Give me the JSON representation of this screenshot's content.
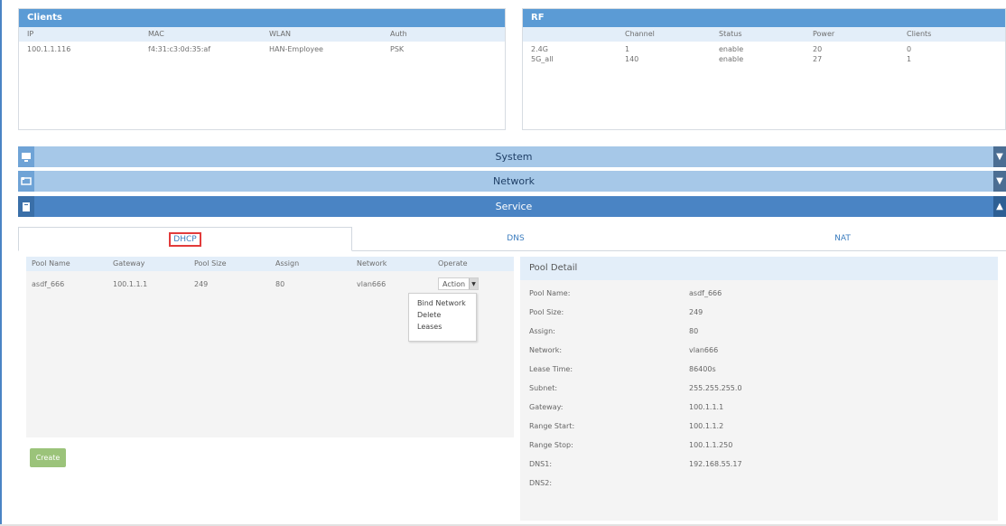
{
  "clients": {
    "title": "Clients",
    "headers": [
      "IP",
      "MAC",
      "WLAN",
      "Auth"
    ],
    "rows": [
      {
        "ip": "100.1.1.116",
        "mac": "f4:31:c3:0d:35:af",
        "wlan": "HAN-Employee",
        "auth": "PSK"
      }
    ]
  },
  "rf": {
    "title": "RF",
    "headers": [
      "",
      "Channel",
      "Status",
      "Power",
      "Clients"
    ],
    "rows": [
      {
        "band": "2.4G",
        "channel": "1",
        "status": "enable",
        "power": "20",
        "clients": "0"
      },
      {
        "band": "5G_all",
        "channel": "140",
        "status": "enable",
        "power": "27",
        "clients": "1"
      }
    ]
  },
  "sections": {
    "system": "System",
    "network": "Network",
    "service": "Service"
  },
  "tabs": [
    "DHCP",
    "DNS",
    "NAT"
  ],
  "pool_table": {
    "headers": [
      "Pool Name",
      "Gateway",
      "Pool Size",
      "Assign",
      "Network",
      "Operate"
    ],
    "rows": [
      {
        "name": "asdf_666",
        "gateway": "100.1.1.1",
        "size": "249",
        "assign": "80",
        "network": "vlan666",
        "action": "Action"
      }
    ],
    "menu": [
      "Bind Network",
      "Delete",
      "Leases"
    ],
    "create": "Create"
  },
  "pool_detail": {
    "title": "Pool Detail",
    "fields": [
      {
        "label": "Pool Name:",
        "value": "asdf_666"
      },
      {
        "label": "Pool Size:",
        "value": "249"
      },
      {
        "label": "Assign:",
        "value": "80"
      },
      {
        "label": "Network:",
        "value": "vlan666"
      },
      {
        "label": "Lease Time:",
        "value": "86400s"
      },
      {
        "label": "Subnet:",
        "value": "255.255.255.0"
      },
      {
        "label": "Gateway:",
        "value": "100.1.1.1"
      },
      {
        "label": "Range Start:",
        "value": "100.1.1.2"
      },
      {
        "label": "Range Stop:",
        "value": "100.1.1.250"
      },
      {
        "label": "DNS1:",
        "value": "192.168.55.17"
      },
      {
        "label": "DNS2:",
        "value": ""
      }
    ]
  },
  "colors": {
    "header_blue": "#5b9bd5",
    "accordion_light": "#a6c8e8",
    "accordion_dark": "#4a84c4",
    "create_green": "#9bc37a",
    "highlight_red": "#e23b3b"
  }
}
